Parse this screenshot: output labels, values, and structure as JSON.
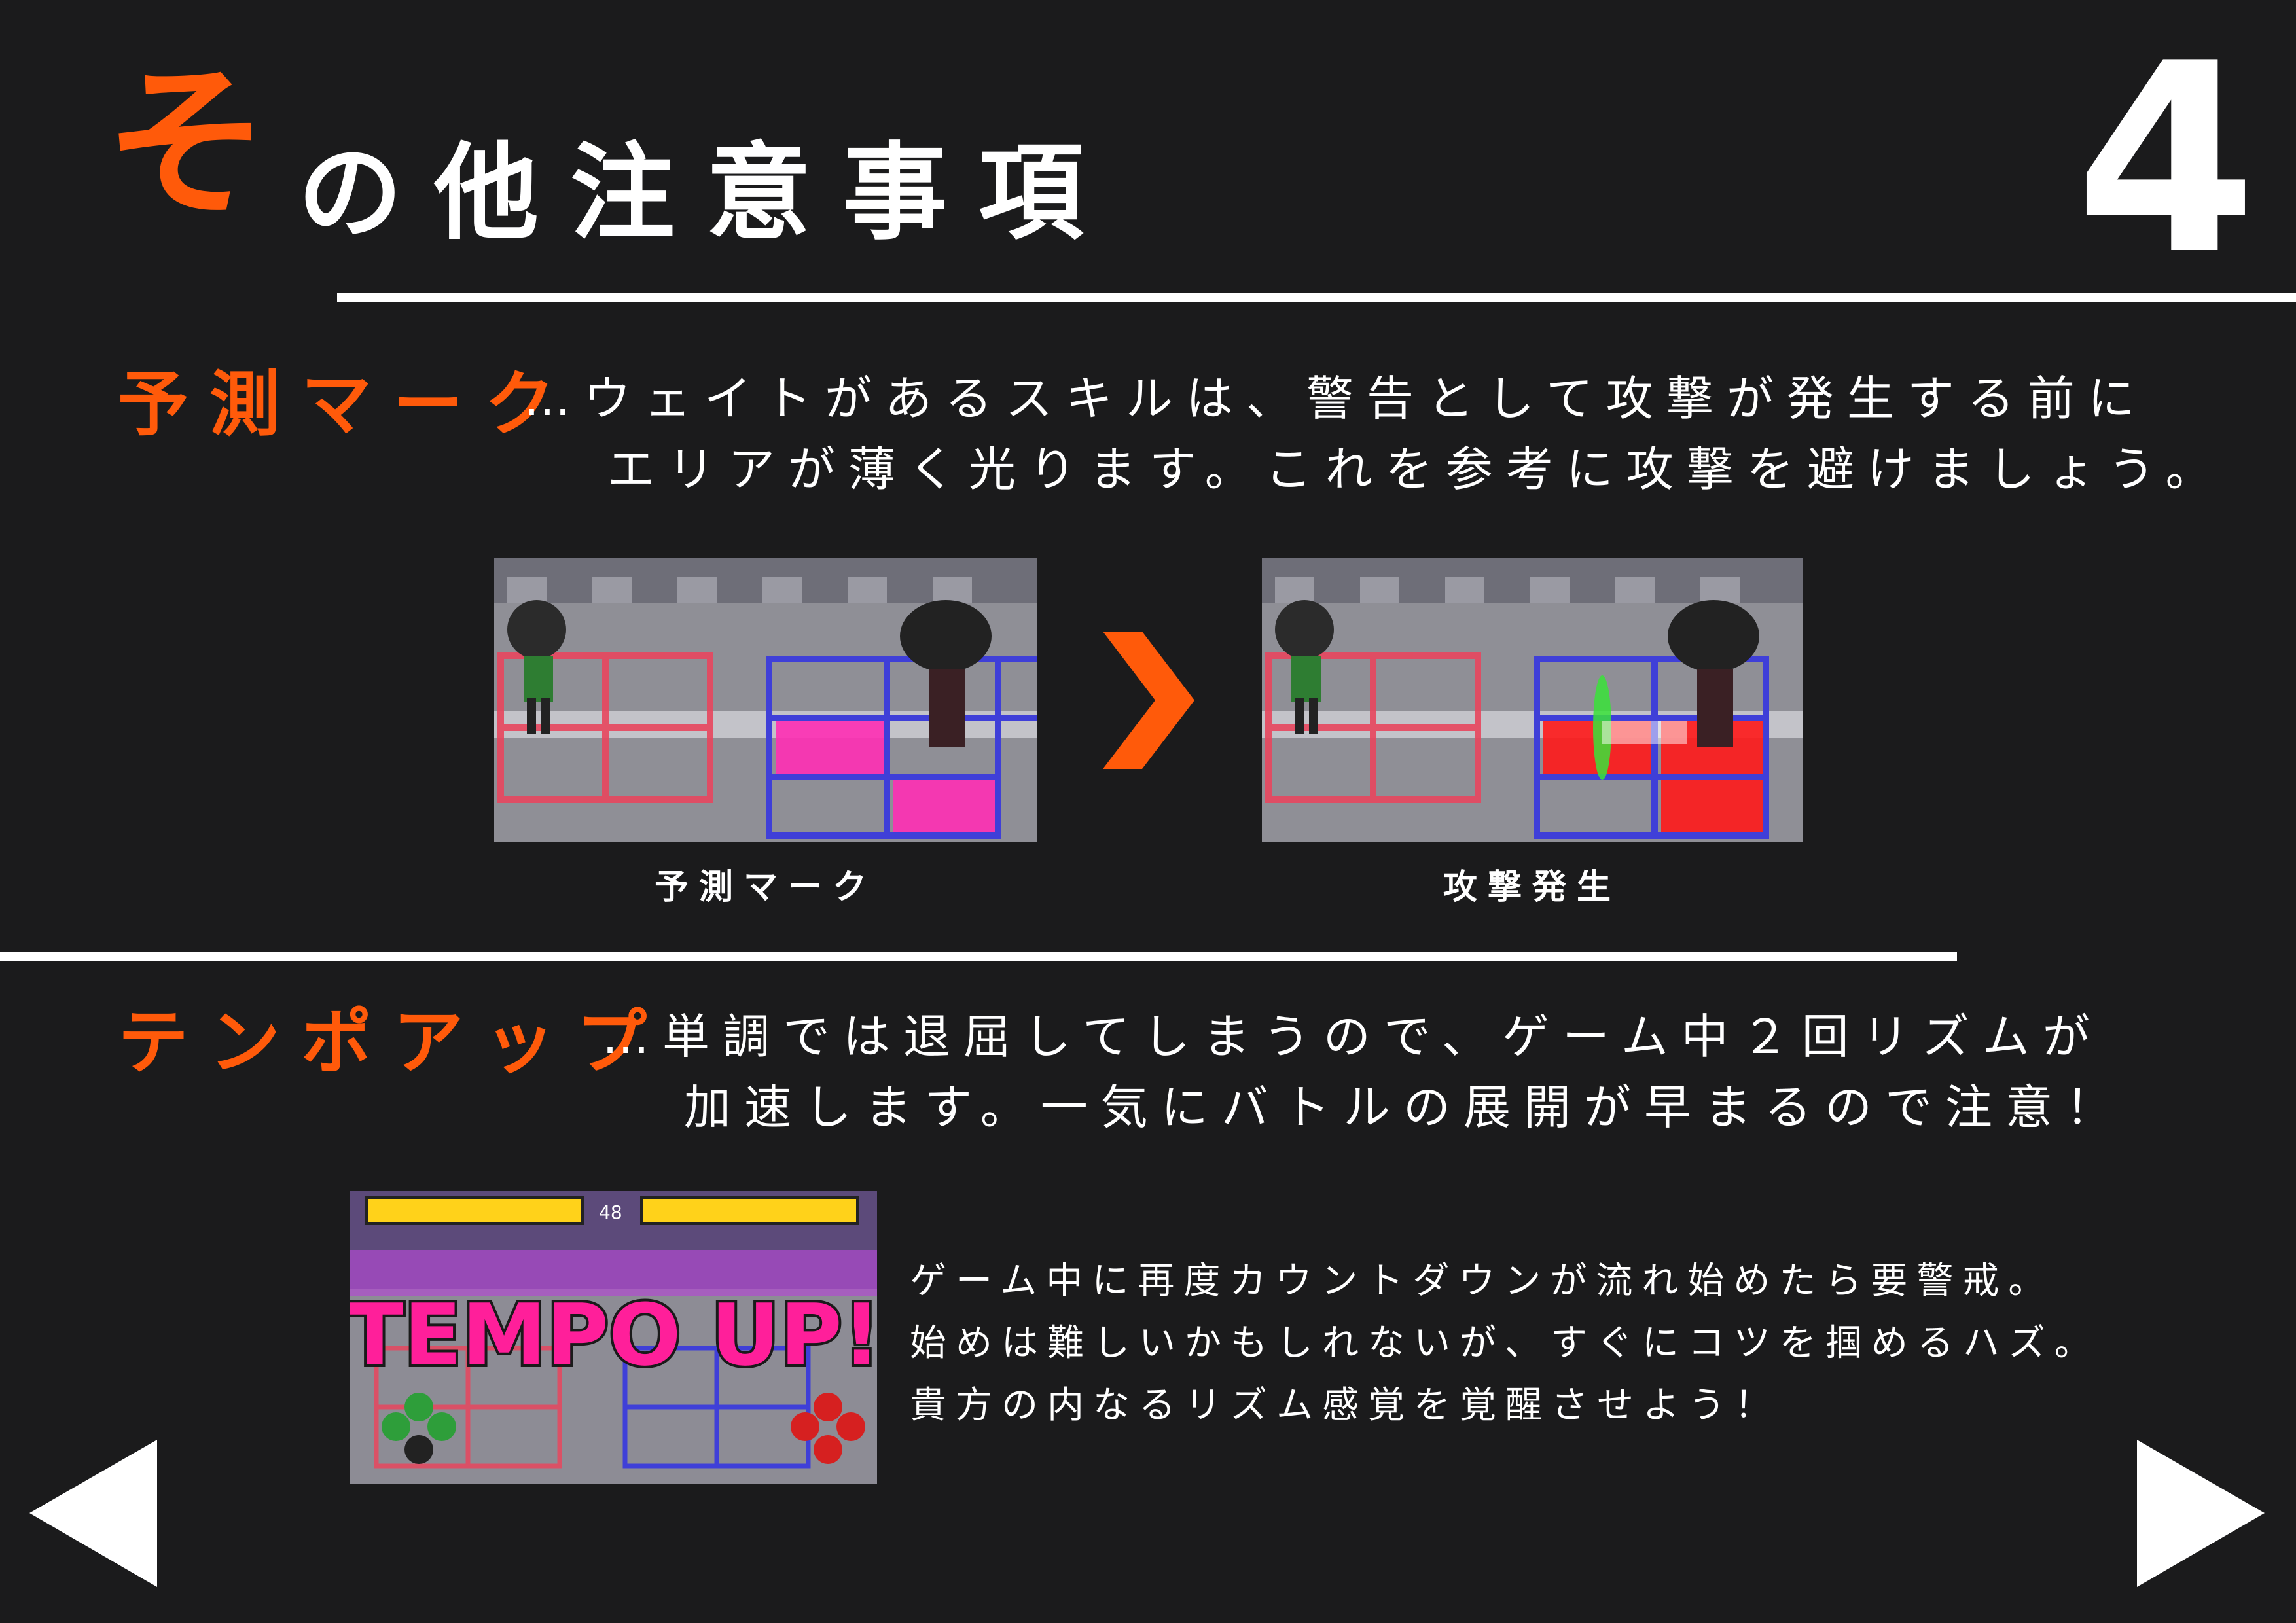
{
  "header": {
    "title_first_char": "そ",
    "title_rest": "の他注意事項",
    "page_number": "4"
  },
  "sections": {
    "prediction": {
      "title": "予測マーク",
      "desc_line1": "…ウェイトがあるスキルは、警告として攻撃が発生する前に",
      "desc_line2": "エリアが薄く光ります。これを参考に攻撃を避けましょう。",
      "image1_caption": "予測マーク",
      "image2_caption": "攻撃発生",
      "arrow_icon": "chevron-right-icon"
    },
    "tempo": {
      "title": "テンポアップ",
      "desc_line1": "…単調では退屈してしまうので、ゲーム中２回リズムが",
      "desc_line2": "加速します。一気にバトルの展開が早まるので注意！",
      "screenshot_banner": "TEMPO UP!",
      "screenshot_timer": "48",
      "note_line1": "ゲーム中に再度カウントダウンが流れ始めたら要警戒。",
      "note_line2": "始めは難しいかもしれないが、すぐにコツを掴めるハズ。",
      "note_line3": "貴方の内なるリズム感覚を覚醒させよう！"
    }
  },
  "nav": {
    "prev_icon": "triangle-left-icon",
    "next_icon": "triangle-right-icon"
  },
  "colors": {
    "background": "#1b1b1c",
    "accent": "#ff5a0a",
    "text": "#ffffff",
    "grid_red": "#e8465e",
    "grid_blue": "#3f3fd8",
    "warning_pink": "#ff2fb4",
    "attack_red": "#ff1a1a",
    "tempo_pink": "#ff1f9a"
  }
}
